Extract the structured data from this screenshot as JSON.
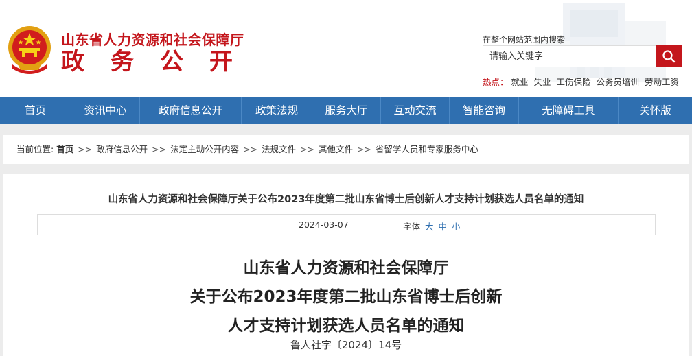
{
  "header": {
    "org_name": "山东省人力资源和社会保障厅",
    "section_name": "政务公开"
  },
  "search": {
    "label": "在整个网站范围内搜索",
    "placeholder": "请输入关键字",
    "hot_label": "热点：",
    "hot_items": [
      "就业",
      "失业",
      "工伤保险",
      "公务员培训",
      "劳动工资"
    ]
  },
  "nav": {
    "items": [
      "首页",
      "资讯中心",
      "政府信息公开",
      "政策法规",
      "服务大厅",
      "互动交流",
      "智能咨询",
      "无障碍工具",
      "关怀版"
    ]
  },
  "breadcrumb": {
    "prefix": "当前位置:",
    "home": "首页",
    "items": [
      "政府信息公开",
      "法定主动公开内容",
      "法规文件",
      "其他文件",
      "省留学人员和专家服务中心"
    ],
    "separator": ">>"
  },
  "article": {
    "head_title": "山东省人力资源和社会保障厅关于公布2023年度第二批山东省博士后创新人才支持计划获选人员名单的通知",
    "date": "2024-03-07",
    "font_label": "字体",
    "font_sizes": [
      "大",
      "中",
      "小"
    ],
    "title_lines": [
      "山东省人力资源和社会保障厅",
      "关于公布2023年度第二批山东省博士后创新",
      "人才支持计划获选人员名单的通知"
    ],
    "doc_number": "鲁人社字〔2024〕14号"
  },
  "colors": {
    "brand_red": "#c4161c",
    "nav_blue": "#2f6fb0"
  }
}
